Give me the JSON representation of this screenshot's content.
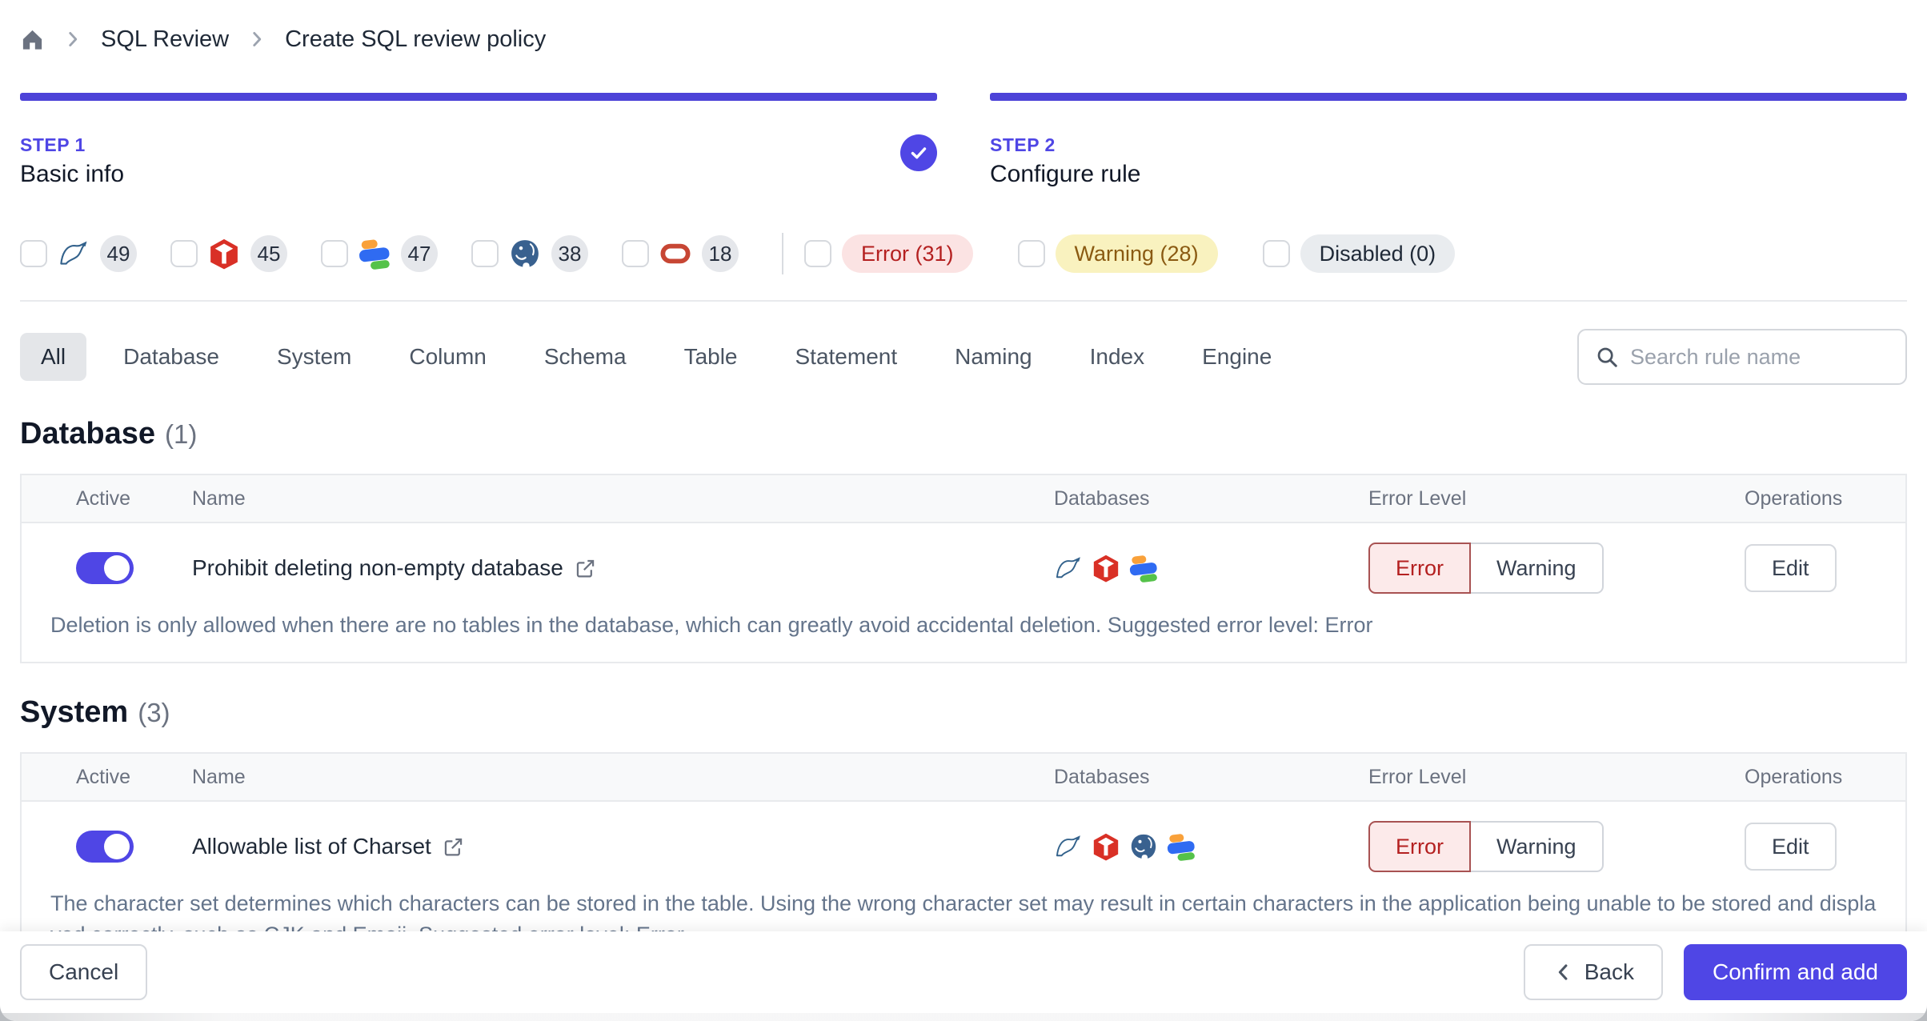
{
  "breadcrumb": {
    "items": [
      "SQL Review",
      "Create SQL review policy"
    ]
  },
  "steps": [
    {
      "label": "STEP 1",
      "name": "Basic info",
      "completed": true
    },
    {
      "label": "STEP 2",
      "name": "Configure rule",
      "completed": false
    }
  ],
  "filters": {
    "engines": [
      {
        "engine": "mysql",
        "count": "49"
      },
      {
        "engine": "tidb",
        "count": "45"
      },
      {
        "engine": "oceanbase",
        "count": "47"
      },
      {
        "engine": "postgresql",
        "count": "38"
      },
      {
        "engine": "oracle",
        "count": "18"
      }
    ],
    "levels": [
      {
        "label": "Error (31)",
        "type": "error"
      },
      {
        "label": "Warning (28)",
        "type": "warning"
      },
      {
        "label": "Disabled (0)",
        "type": "disabled"
      }
    ]
  },
  "tabs": {
    "items": [
      "All",
      "Database",
      "System",
      "Column",
      "Schema",
      "Table",
      "Statement",
      "Naming",
      "Index",
      "Engine"
    ],
    "active": "All"
  },
  "search": {
    "placeholder": "Search rule name"
  },
  "table": {
    "columns": [
      "Active",
      "Name",
      "Databases",
      "Error Level",
      "Operations"
    ],
    "level_error": "Error",
    "level_warning": "Warning",
    "edit_label": "Edit"
  },
  "sections": [
    {
      "title": "Database",
      "count": "(1)",
      "rules": [
        {
          "name": "Prohibit deleting non-empty database",
          "active": true,
          "engines": [
            "mysql",
            "tidb",
            "oceanbase"
          ],
          "selected_level": "Error",
          "description": "Deletion is only allowed when there are no tables in the database, which can greatly avoid accidental deletion. Suggested error level: Error"
        }
      ]
    },
    {
      "title": "System",
      "count": "(3)",
      "rules": [
        {
          "name": "Allowable list of Charset",
          "active": true,
          "engines": [
            "mysql",
            "tidb",
            "postgresql",
            "oceanbase"
          ],
          "selected_level": "Error",
          "description": "The character set determines which characters can be stored in the table. Using the wrong character set may result in certain characters in the application being unable to be stored and displayed correctly, such as CJK and Emoji. Suggested error level: Error"
        }
      ]
    }
  ],
  "footer": {
    "cancel": "Cancel",
    "back": "Back",
    "confirm": "Confirm and add"
  },
  "colors": {
    "accent": "#4f46e5",
    "error_text": "#b42020",
    "error_bg": "#fbe3e3",
    "warning_text": "#8a5a12",
    "warning_bg": "#f9f2bf",
    "disabled_bg": "#e9ecef",
    "border": "#e5e7eb"
  }
}
